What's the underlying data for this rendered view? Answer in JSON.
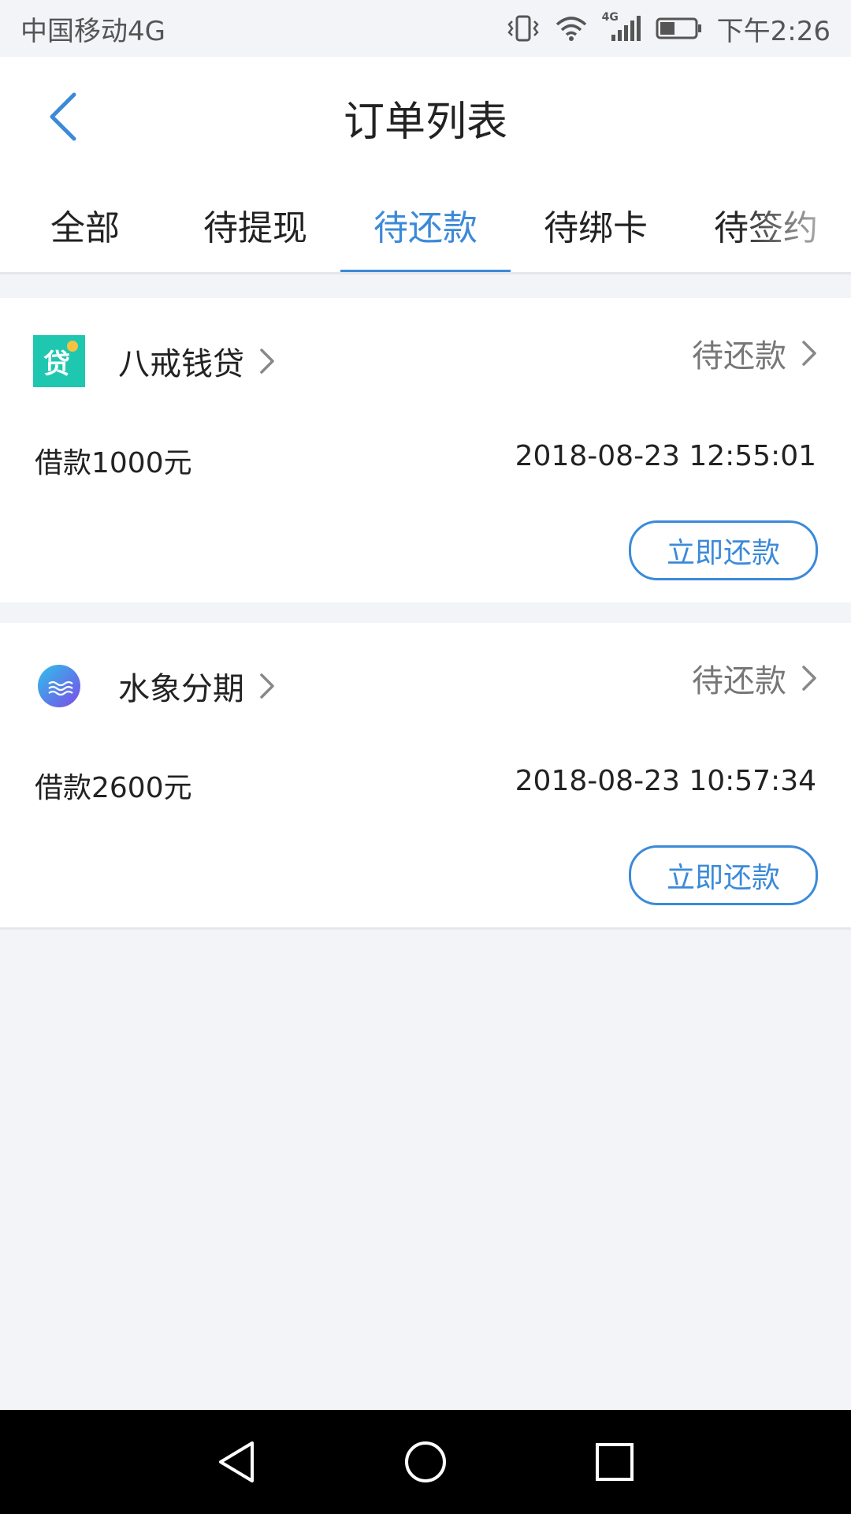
{
  "status_bar": {
    "carrier": "中国移动4G",
    "time": "下午2:26",
    "network_badge": "4G"
  },
  "header": {
    "title": "订单列表"
  },
  "tabs": [
    {
      "label": "全部",
      "active": false
    },
    {
      "label": "待提现",
      "active": false
    },
    {
      "label": "待还款",
      "active": true
    },
    {
      "label": "待绑卡",
      "active": false
    },
    {
      "label": "待签约",
      "active": false
    }
  ],
  "orders": [
    {
      "merchant": "八戒钱贷",
      "logo_text": "贷",
      "status": "待还款",
      "amount": "借款1000元",
      "time": "2018-08-23 12:55:01",
      "action": "立即还款"
    },
    {
      "merchant": "水象分期",
      "status": "待还款",
      "amount": "借款2600元",
      "time": "2018-08-23 10:57:34",
      "action": "立即还款"
    }
  ],
  "colors": {
    "accent": "#3b8ad9",
    "logo1_bg": "#1fc7b0",
    "logo2_start": "#2fc0ea",
    "logo2_end": "#7b4ce8"
  },
  "icons": {
    "back": "chevron-left-icon",
    "chevron": "chevron-right-icon",
    "nav_back": "triangle-back-icon",
    "nav_home": "circle-home-icon",
    "nav_recent": "square-recents-icon"
  }
}
